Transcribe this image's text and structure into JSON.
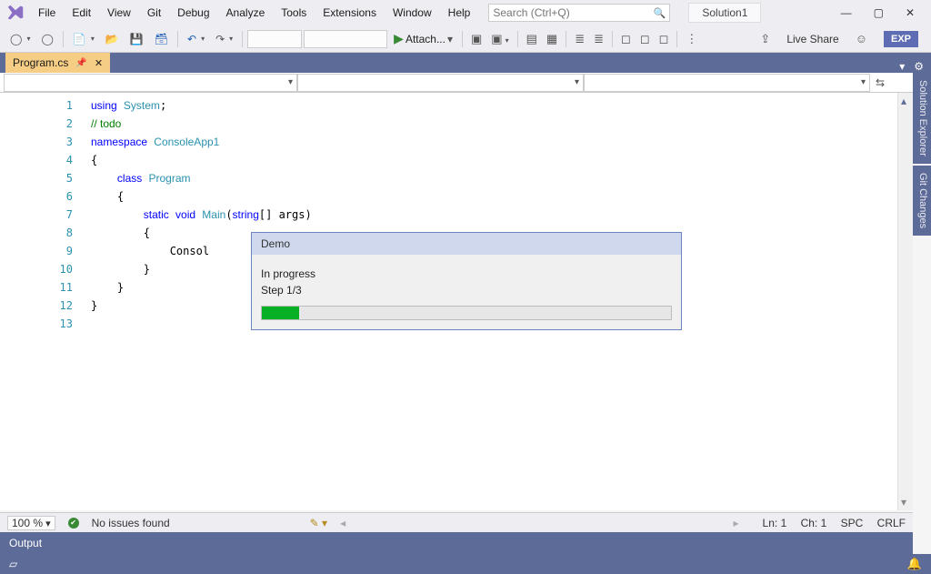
{
  "menu": {
    "items": [
      "File",
      "Edit",
      "View",
      "Git",
      "Debug",
      "Analyze",
      "Tools",
      "Extensions",
      "Window",
      "Help"
    ]
  },
  "search": {
    "placeholder": "Search (Ctrl+Q)"
  },
  "solution_name": "Solution1",
  "window_controls": {
    "min": "—",
    "max": "▢",
    "close": "✕"
  },
  "toolbar": {
    "attach_label": "Attach...",
    "liveshare_label": "Live Share",
    "exp_label": "EXP"
  },
  "file_tab": {
    "name": "Program.cs"
  },
  "side_tabs": [
    "Solution Explorer",
    "Git Changes"
  ],
  "code_lines": [
    "using System;",
    "// todo",
    "namespace ConsoleApp1",
    "{",
    "    class Program",
    "    {",
    "        static void Main(string[] args)",
    "        {",
    "            Consol",
    "        }",
    "    }",
    "}",
    ""
  ],
  "line_count": 13,
  "dialog": {
    "title": "Demo",
    "status": "In progress",
    "step": "Step 1/3",
    "percent": 9
  },
  "edit_status": {
    "zoom": "100 %",
    "issues": "No issues found",
    "line": "Ln: 1",
    "col": "Ch: 1",
    "indent": "SPC",
    "eol": "CRLF"
  },
  "output_title": "Output"
}
